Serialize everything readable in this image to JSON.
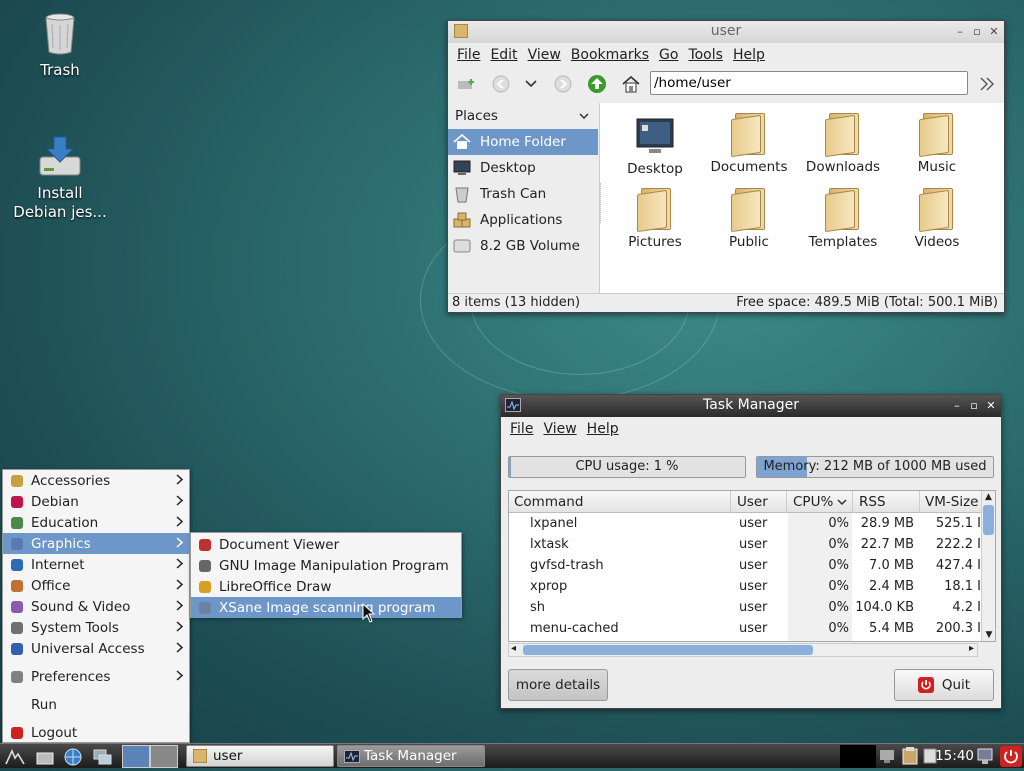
{
  "desktop": {
    "icons": [
      {
        "label": "Trash",
        "icon": "trash-icon"
      },
      {
        "label": "Install\nDebian jes...",
        "icon": "install-drive-icon"
      }
    ]
  },
  "file_manager": {
    "title": "user",
    "menu": [
      "File",
      "Edit",
      "View",
      "Bookmarks",
      "Go",
      "Tools",
      "Help"
    ],
    "address": "/home/user",
    "places_label": "Places",
    "places": [
      {
        "label": "Home Folder",
        "icon": "home-icon",
        "selected": true
      },
      {
        "label": "Desktop",
        "icon": "desktop-icon"
      },
      {
        "label": "Trash Can",
        "icon": "trash-icon"
      },
      {
        "label": "Applications",
        "icon": "applications-icon"
      },
      {
        "label": "8.2 GB Volume",
        "icon": "drive-icon"
      }
    ],
    "items": [
      {
        "label": "Desktop",
        "icon": "desktop-icon"
      },
      {
        "label": "Documents",
        "icon": "folder-icon"
      },
      {
        "label": "Downloads",
        "icon": "folder-icon"
      },
      {
        "label": "Music",
        "icon": "folder-icon"
      },
      {
        "label": "Pictures",
        "icon": "folder-icon"
      },
      {
        "label": "Public",
        "icon": "folder-icon"
      },
      {
        "label": "Templates",
        "icon": "folder-icon"
      },
      {
        "label": "Videos",
        "icon": "folder-icon"
      }
    ],
    "status_left": "8 items (13 hidden)",
    "status_right": "Free space: 489.5 MiB (Total: 500.1 MiB)"
  },
  "task_manager": {
    "title": "Task Manager",
    "menu": [
      "File",
      "View",
      "Help"
    ],
    "cpu_label": "CPU usage: 1 %",
    "cpu_fraction": 0.01,
    "memory_label": "Memory: 212 MB of 1000 MB used",
    "memory_fraction": 0.212,
    "columns": [
      "Command",
      "User",
      "CPU%",
      "RSS",
      "VM-Size"
    ],
    "rows": [
      {
        "command": "lxpanel",
        "user": "user",
        "cpu": "0%",
        "rss": "28.9 MB",
        "vm": "525.1 I"
      },
      {
        "command": "lxtask",
        "user": "user",
        "cpu": "0%",
        "rss": "22.7 MB",
        "vm": "222.2 I"
      },
      {
        "command": "gvfsd-trash",
        "user": "user",
        "cpu": "0%",
        "rss": "7.0 MB",
        "vm": "427.4 I"
      },
      {
        "command": "xprop",
        "user": "user",
        "cpu": "0%",
        "rss": "2.4 MB",
        "vm": "18.1 I"
      },
      {
        "command": "sh",
        "user": "user",
        "cpu": "0%",
        "rss": "104.0 KB",
        "vm": "4.2 I"
      },
      {
        "command": "menu-cached",
        "user": "user",
        "cpu": "0%",
        "rss": "5.4 MB",
        "vm": "200.3 I"
      }
    ],
    "more_details": "more details",
    "quit": "Quit"
  },
  "app_menu": {
    "items": [
      {
        "label": "Accessories",
        "icon": "accessories-icon",
        "submenu": true
      },
      {
        "label": "Debian",
        "icon": "debian-icon",
        "submenu": true
      },
      {
        "label": "Education",
        "icon": "education-icon",
        "submenu": true
      },
      {
        "label": "Graphics",
        "icon": "graphics-icon",
        "submenu": true,
        "selected": true
      },
      {
        "label": "Internet",
        "icon": "internet-icon",
        "submenu": true
      },
      {
        "label": "Office",
        "icon": "office-icon",
        "submenu": true
      },
      {
        "label": "Sound & Video",
        "icon": "sound-video-icon",
        "submenu": true
      },
      {
        "label": "System Tools",
        "icon": "system-tools-icon",
        "submenu": true
      },
      {
        "label": "Universal Access",
        "icon": "universal-access-icon",
        "submenu": true
      },
      {
        "label": "Preferences",
        "icon": "preferences-icon",
        "submenu": true
      },
      {
        "label": "Run",
        "icon": "",
        "submenu": false
      },
      {
        "label": "Logout",
        "icon": "logout-icon",
        "submenu": false
      }
    ],
    "graphics_submenu": [
      {
        "label": "Document Viewer",
        "icon": "document-viewer-icon"
      },
      {
        "label": "GNU Image Manipulation Program",
        "icon": "gimp-icon"
      },
      {
        "label": "LibreOffice Draw",
        "icon": "libreoffice-draw-icon"
      },
      {
        "label": "XSane Image scanning program",
        "icon": "xsane-icon",
        "selected": true
      }
    ]
  },
  "taskbar": {
    "tasks": [
      {
        "label": "user",
        "icon": "folder-icon"
      },
      {
        "label": "Task Manager",
        "icon": "task-manager-icon"
      }
    ],
    "clock": "15:40"
  },
  "colors": {
    "selection": "#6d97c9",
    "accent_green": "#3a9a2a",
    "quit_red": "#d02020"
  }
}
